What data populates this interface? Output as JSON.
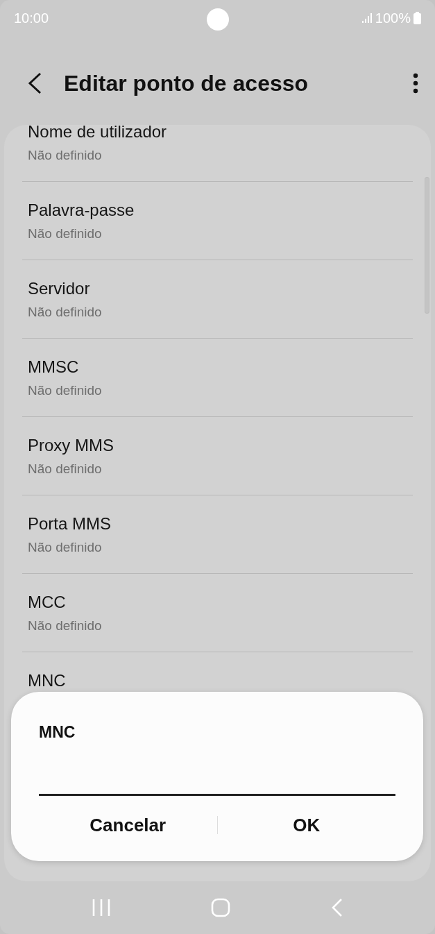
{
  "status_bar": {
    "time": "10:00",
    "battery": "100%"
  },
  "app_bar": {
    "title": "Editar ponto de acesso"
  },
  "settings": [
    {
      "title": "Nome de utilizador",
      "value": "Não definido"
    },
    {
      "title": "Palavra-passe",
      "value": "Não definido"
    },
    {
      "title": "Servidor",
      "value": "Não definido"
    },
    {
      "title": "MMSC",
      "value": "Não definido"
    },
    {
      "title": "Proxy MMS",
      "value": "Não definido"
    },
    {
      "title": "Porta MMS",
      "value": "Não definido"
    },
    {
      "title": "MCC",
      "value": "Não definido"
    },
    {
      "title": "MNC"
    }
  ],
  "dialog": {
    "title": "MNC",
    "buttons": [
      "Cancelar",
      "OK"
    ]
  }
}
